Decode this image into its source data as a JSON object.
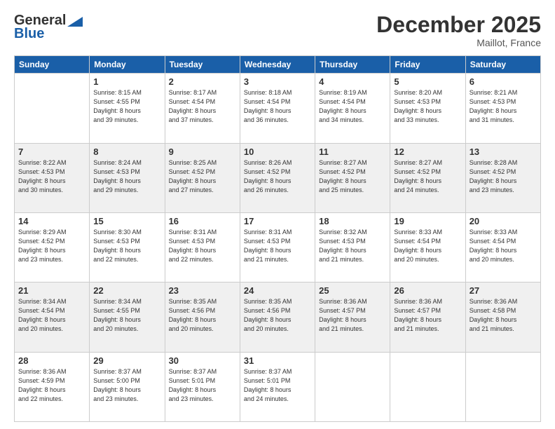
{
  "header": {
    "logo_general": "General",
    "logo_blue": "Blue",
    "month": "December 2025",
    "location": "Maillot, France"
  },
  "columns": [
    "Sunday",
    "Monday",
    "Tuesday",
    "Wednesday",
    "Thursday",
    "Friday",
    "Saturday"
  ],
  "weeks": [
    [
      {
        "day": "",
        "info": ""
      },
      {
        "day": "1",
        "info": "Sunrise: 8:15 AM\nSunset: 4:55 PM\nDaylight: 8 hours\nand 39 minutes."
      },
      {
        "day": "2",
        "info": "Sunrise: 8:17 AM\nSunset: 4:54 PM\nDaylight: 8 hours\nand 37 minutes."
      },
      {
        "day": "3",
        "info": "Sunrise: 8:18 AM\nSunset: 4:54 PM\nDaylight: 8 hours\nand 36 minutes."
      },
      {
        "day": "4",
        "info": "Sunrise: 8:19 AM\nSunset: 4:54 PM\nDaylight: 8 hours\nand 34 minutes."
      },
      {
        "day": "5",
        "info": "Sunrise: 8:20 AM\nSunset: 4:53 PM\nDaylight: 8 hours\nand 33 minutes."
      },
      {
        "day": "6",
        "info": "Sunrise: 8:21 AM\nSunset: 4:53 PM\nDaylight: 8 hours\nand 31 minutes."
      }
    ],
    [
      {
        "day": "7",
        "info": "Sunrise: 8:22 AM\nSunset: 4:53 PM\nDaylight: 8 hours\nand 30 minutes."
      },
      {
        "day": "8",
        "info": "Sunrise: 8:24 AM\nSunset: 4:53 PM\nDaylight: 8 hours\nand 29 minutes."
      },
      {
        "day": "9",
        "info": "Sunrise: 8:25 AM\nSunset: 4:52 PM\nDaylight: 8 hours\nand 27 minutes."
      },
      {
        "day": "10",
        "info": "Sunrise: 8:26 AM\nSunset: 4:52 PM\nDaylight: 8 hours\nand 26 minutes."
      },
      {
        "day": "11",
        "info": "Sunrise: 8:27 AM\nSunset: 4:52 PM\nDaylight: 8 hours\nand 25 minutes."
      },
      {
        "day": "12",
        "info": "Sunrise: 8:27 AM\nSunset: 4:52 PM\nDaylight: 8 hours\nand 24 minutes."
      },
      {
        "day": "13",
        "info": "Sunrise: 8:28 AM\nSunset: 4:52 PM\nDaylight: 8 hours\nand 23 minutes."
      }
    ],
    [
      {
        "day": "14",
        "info": "Sunrise: 8:29 AM\nSunset: 4:52 PM\nDaylight: 8 hours\nand 23 minutes."
      },
      {
        "day": "15",
        "info": "Sunrise: 8:30 AM\nSunset: 4:53 PM\nDaylight: 8 hours\nand 22 minutes."
      },
      {
        "day": "16",
        "info": "Sunrise: 8:31 AM\nSunset: 4:53 PM\nDaylight: 8 hours\nand 22 minutes."
      },
      {
        "day": "17",
        "info": "Sunrise: 8:31 AM\nSunset: 4:53 PM\nDaylight: 8 hours\nand 21 minutes."
      },
      {
        "day": "18",
        "info": "Sunrise: 8:32 AM\nSunset: 4:53 PM\nDaylight: 8 hours\nand 21 minutes."
      },
      {
        "day": "19",
        "info": "Sunrise: 8:33 AM\nSunset: 4:54 PM\nDaylight: 8 hours\nand 20 minutes."
      },
      {
        "day": "20",
        "info": "Sunrise: 8:33 AM\nSunset: 4:54 PM\nDaylight: 8 hours\nand 20 minutes."
      }
    ],
    [
      {
        "day": "21",
        "info": "Sunrise: 8:34 AM\nSunset: 4:54 PM\nDaylight: 8 hours\nand 20 minutes."
      },
      {
        "day": "22",
        "info": "Sunrise: 8:34 AM\nSunset: 4:55 PM\nDaylight: 8 hours\nand 20 minutes."
      },
      {
        "day": "23",
        "info": "Sunrise: 8:35 AM\nSunset: 4:56 PM\nDaylight: 8 hours\nand 20 minutes."
      },
      {
        "day": "24",
        "info": "Sunrise: 8:35 AM\nSunset: 4:56 PM\nDaylight: 8 hours\nand 20 minutes."
      },
      {
        "day": "25",
        "info": "Sunrise: 8:36 AM\nSunset: 4:57 PM\nDaylight: 8 hours\nand 21 minutes."
      },
      {
        "day": "26",
        "info": "Sunrise: 8:36 AM\nSunset: 4:57 PM\nDaylight: 8 hours\nand 21 minutes."
      },
      {
        "day": "27",
        "info": "Sunrise: 8:36 AM\nSunset: 4:58 PM\nDaylight: 8 hours\nand 21 minutes."
      }
    ],
    [
      {
        "day": "28",
        "info": "Sunrise: 8:36 AM\nSunset: 4:59 PM\nDaylight: 8 hours\nand 22 minutes."
      },
      {
        "day": "29",
        "info": "Sunrise: 8:37 AM\nSunset: 5:00 PM\nDaylight: 8 hours\nand 23 minutes."
      },
      {
        "day": "30",
        "info": "Sunrise: 8:37 AM\nSunset: 5:01 PM\nDaylight: 8 hours\nand 23 minutes."
      },
      {
        "day": "31",
        "info": "Sunrise: 8:37 AM\nSunset: 5:01 PM\nDaylight: 8 hours\nand 24 minutes."
      },
      {
        "day": "",
        "info": ""
      },
      {
        "day": "",
        "info": ""
      },
      {
        "day": "",
        "info": ""
      }
    ]
  ]
}
